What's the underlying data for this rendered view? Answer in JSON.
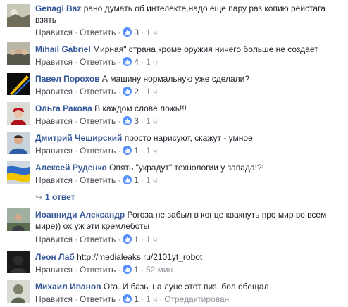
{
  "comments": [
    {
      "author": "Genagi Baz",
      "text": "рано думать об интелекте,надо еще пару раз копию рейстага взять",
      "like_label": "Нравится",
      "reply_label": "Ответить",
      "likes": "3",
      "time": "1 ч",
      "avatar_icon": "landscape-avatar-icon"
    },
    {
      "author": "Mihail Gabriel",
      "text": "Мирная\" страна кроме оружия ничего больше не создает",
      "like_label": "Нравится",
      "reply_label": "Ответить",
      "likes": "4",
      "time": "1 ч",
      "avatar_icon": "group-photo-avatar-icon"
    },
    {
      "author": "Павел Порохов",
      "text": "А машину нормальную уже сделали?",
      "like_label": "Нравится",
      "reply_label": "Ответить",
      "likes": "2",
      "time": "1 ч",
      "avatar_icon": "ribbon-avatar-icon"
    },
    {
      "author": "Ольга Ракова",
      "text": "В каждом слове ложь!!!",
      "like_label": "Нравится",
      "reply_label": "Ответить",
      "likes": "3",
      "time": "1 ч",
      "avatar_icon": "woman-red-hat-avatar-icon"
    },
    {
      "author": "Дмитрий Чеширский",
      "text": "просто нарисуют, скажут - умное",
      "like_label": "Нравится",
      "reply_label": "Ответить",
      "likes": "1",
      "time": "1 ч",
      "avatar_icon": "man-portrait-avatar-icon"
    },
    {
      "author": "Алексей Руденко",
      "text": "Опять \"украдут\" технологии у запада!?!",
      "like_label": "Нравится",
      "reply_label": "Ответить",
      "likes": "1",
      "time": "1 ч",
      "avatar_icon": "flag-avatar-icon"
    },
    {
      "author": "Иоанниди Александр",
      "text": "Рогоза не забыл в конце квакнуть про мир во всем мире)) ох уж эти кремлеботы",
      "like_label": "Нравится",
      "reply_label": "Ответить",
      "likes": "1",
      "time": "1 ч",
      "avatar_icon": "outdoor-avatar-icon"
    },
    {
      "author": "Леон Лаб",
      "text": "http://medialeaks.ru/2101yt_robot",
      "like_label": "Нравится",
      "reply_label": "Ответить",
      "likes": "1",
      "time": "52 мин.",
      "avatar_icon": "dark-avatar-icon"
    },
    {
      "author": "Михаил Иванов",
      "text": "Ога. И базы на луне этот пиз..бол обещал",
      "like_label": "Нравится",
      "reply_label": "Ответить",
      "likes": "1",
      "time": "1 ч",
      "edited": "Отредактирован",
      "avatar_icon": "statue-avatar-icon"
    }
  ],
  "replies": {
    "label": "1 ответ",
    "arrow_icon": "reply-arrow-icon"
  },
  "colors": {
    "name": "#365899",
    "like_badge": "#5890ff",
    "meta": "#90949c"
  }
}
